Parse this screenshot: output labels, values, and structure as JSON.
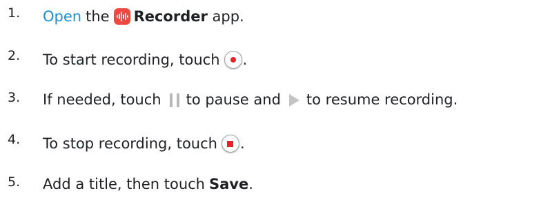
{
  "colors": {
    "link": "#1a8fd6",
    "record_red": "#e8222a",
    "app_icon_bg": "#f0483e",
    "icon_gray": "#c4c4c4"
  },
  "steps": [
    {
      "number": "1.",
      "link_text": "Open",
      "text_before_icon": " the",
      "app_icon": "recorder-app-icon",
      "app_name": "Recorder",
      "text_after": " app."
    },
    {
      "number": "2.",
      "text": "To start recording, touch",
      "icon": "record-button-icon",
      "text_after": "."
    },
    {
      "number": "3.",
      "text": "If needed, touch",
      "icon_1": "pause-icon",
      "text_middle": "to pause and",
      "icon_2": "play-icon",
      "text_after": "to resume recording."
    },
    {
      "number": "4.",
      "text": "To stop recording, touch",
      "icon": "stop-button-icon",
      "text_after": "."
    },
    {
      "number": "5.",
      "text": "Add a title, then touch",
      "bold_text": "Save",
      "text_after": "."
    }
  ]
}
